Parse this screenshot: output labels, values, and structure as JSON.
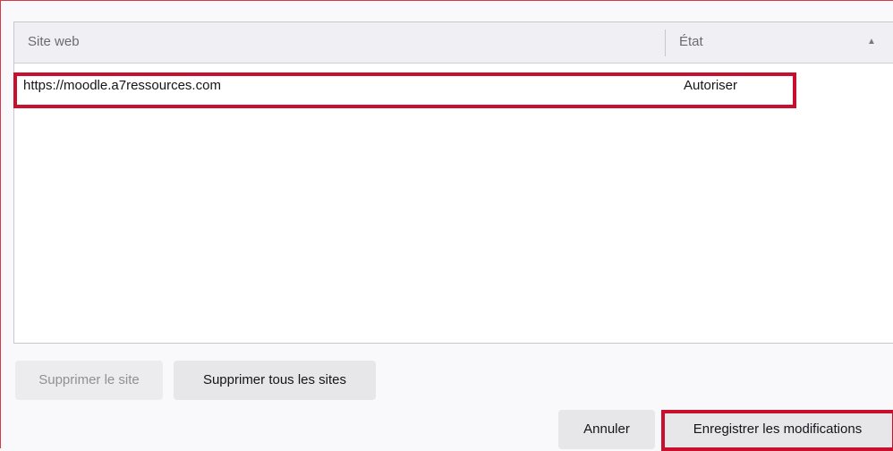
{
  "list": {
    "columns": {
      "site": "Site web",
      "state": "État"
    },
    "sort_icon": "sort-ascending-icon",
    "rows": [
      {
        "url": "https://moodle.a7ressources.com",
        "state": "Autoriser"
      }
    ]
  },
  "buttons": {
    "remove_site": "Supprimer le site",
    "remove_all": "Supprimer tous les sites",
    "cancel": "Annuler",
    "save": "Enregistrer les modifications"
  },
  "colors": {
    "highlight": "#c8102e",
    "frame": "#d93a4a"
  }
}
